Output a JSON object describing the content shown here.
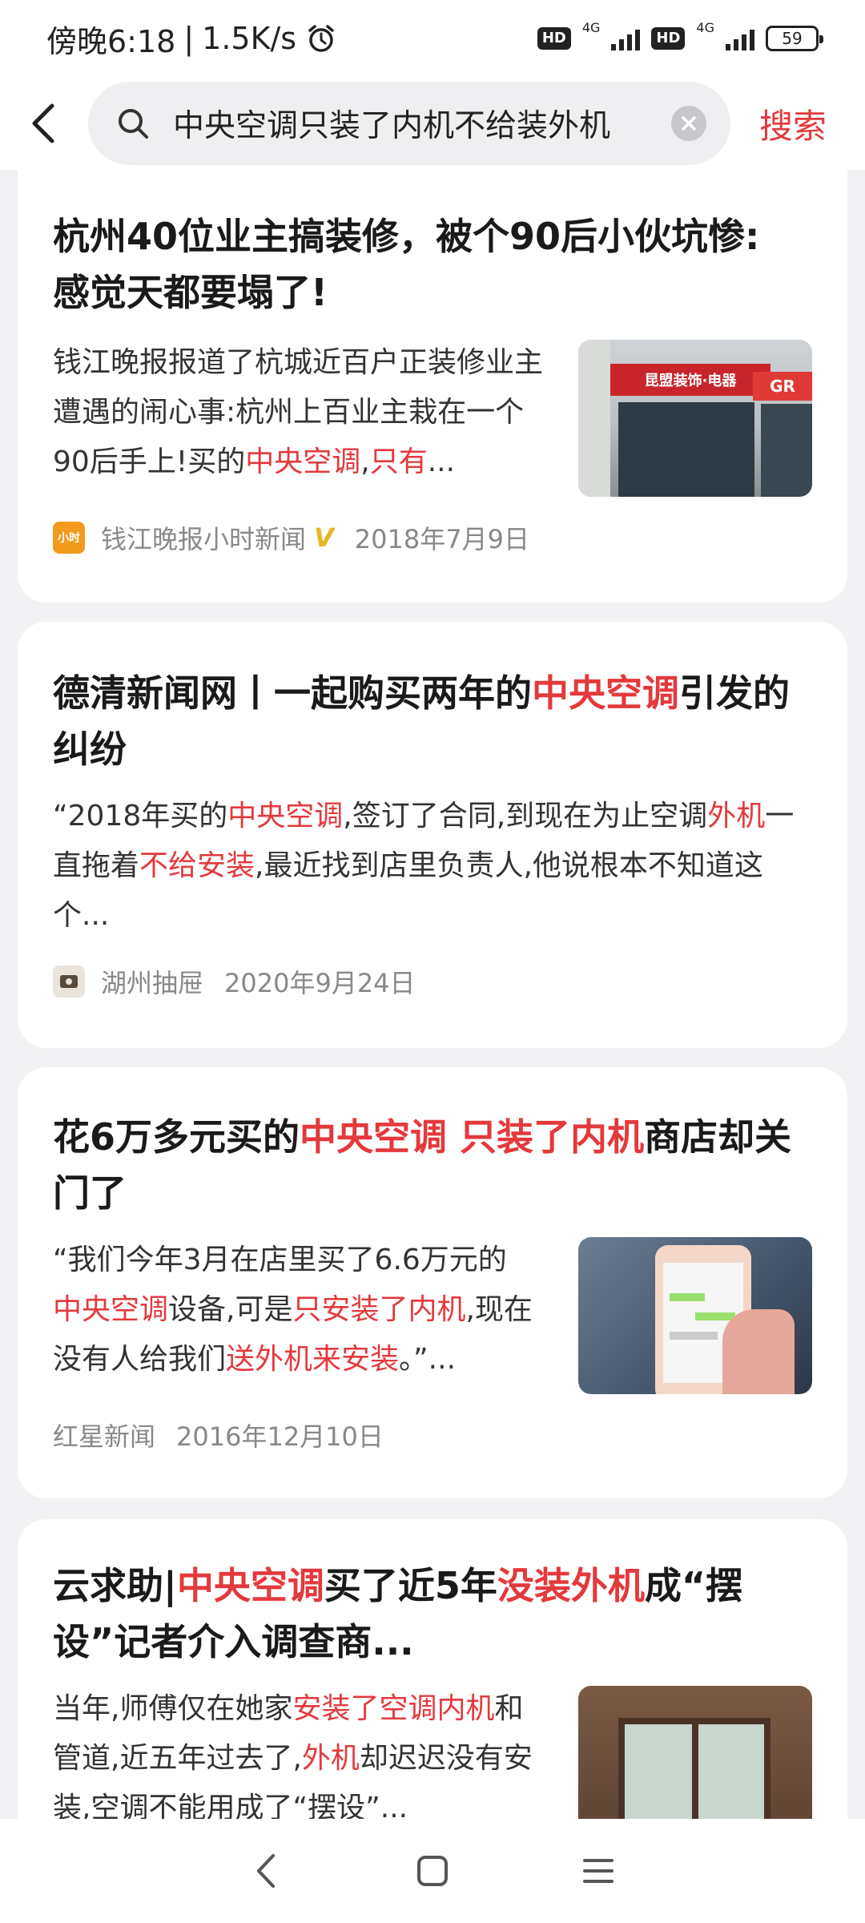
{
  "status_bar": {
    "time": "傍晚6:18",
    "speed": "1.5K/s",
    "alarm_icon": "alarm-icon",
    "hd1": "HD",
    "net1": "4G",
    "hd2": "HD",
    "net2": "4G",
    "battery": "59"
  },
  "search": {
    "query": "中央空调只装了内机不给装外机",
    "submit_label": "搜索",
    "back_icon": "back-arrow-icon",
    "search_icon": "search-icon",
    "clear_icon": "clear-icon"
  },
  "results": [
    {
      "title_parts": [
        {
          "t": "杭州40位业主搞装修，被个90后小伙坑惨:",
          "hl": false
        },
        {
          "t": "感觉天都要塌了!",
          "hl": false
        }
      ],
      "snippet_parts": [
        {
          "t": "钱江晚报报道了杭城近百户正装修业主遭遇的闹心事:杭州上百业主栽在一个90后手上!买的",
          "hl": false
        },
        {
          "t": "中央空调",
          "hl": true
        },
        {
          "t": ",",
          "hl": false
        },
        {
          "t": "只有",
          "hl": true
        },
        {
          "t": "...",
          "hl": false
        }
      ],
      "source": "钱江晚报小时新闻",
      "verified": "V",
      "date": "2018年7月9日",
      "thumb_sign": "昆盟装饰·电器",
      "thumb_sign2": "GR"
    },
    {
      "title_parts": [
        {
          "t": "德清新闻网丨一起购买两年的",
          "hl": false
        },
        {
          "t": "中央空调",
          "hl": true
        },
        {
          "t": "引发的纠纷",
          "hl": false
        }
      ],
      "snippet_parts": [
        {
          "t": "“2018年买的",
          "hl": false
        },
        {
          "t": "中央空调",
          "hl": true
        },
        {
          "t": ",签订了合同,到现在为止空调",
          "hl": false
        },
        {
          "t": "外机",
          "hl": true
        },
        {
          "t": "一直拖着",
          "hl": false
        },
        {
          "t": "不给安装",
          "hl": true
        },
        {
          "t": ",最近找到店里负责人,他说根本不知道这个...",
          "hl": false
        }
      ],
      "source": "湖州抽屉",
      "date": "2020年9月24日"
    },
    {
      "title_parts": [
        {
          "t": "花6万多元买的",
          "hl": false
        },
        {
          "t": "中央空调 只装了内机",
          "hl": true
        },
        {
          "t": "商店却关门了",
          "hl": false
        }
      ],
      "snippet_parts": [
        {
          "t": "“我们今年3月在店里买了6.6万元的",
          "hl": false
        },
        {
          "t": "中央空调",
          "hl": true
        },
        {
          "t": "设备,可是",
          "hl": false
        },
        {
          "t": "只安装了内机",
          "hl": true
        },
        {
          "t": ",现在没有人给我们",
          "hl": false
        },
        {
          "t": "送外机来安装",
          "hl": true
        },
        {
          "t": "。”...",
          "hl": false
        }
      ],
      "source": "红星新闻",
      "date": "2016年12月10日"
    },
    {
      "title_parts": [
        {
          "t": "云求助|",
          "hl": false
        },
        {
          "t": "中央空调",
          "hl": true
        },
        {
          "t": "买了近5年",
          "hl": false
        },
        {
          "t": "没装外机",
          "hl": true
        },
        {
          "t": "成“摆设”记者介入调查商...",
          "hl": false
        }
      ],
      "snippet_parts": [
        {
          "t": "当年,师傅仅在她家",
          "hl": false
        },
        {
          "t": "安装了空调内机",
          "hl": true
        },
        {
          "t": "和管道,近五年过去了,",
          "hl": false
        },
        {
          "t": "外机",
          "hl": true
        },
        {
          "t": "却迟迟没有安装,空调不能用成了“摆设”...",
          "hl": false
        }
      ]
    }
  ],
  "nav": {
    "back_icon": "nav-back-icon",
    "home_icon": "nav-home-icon",
    "menu_icon": "nav-menu-icon"
  }
}
